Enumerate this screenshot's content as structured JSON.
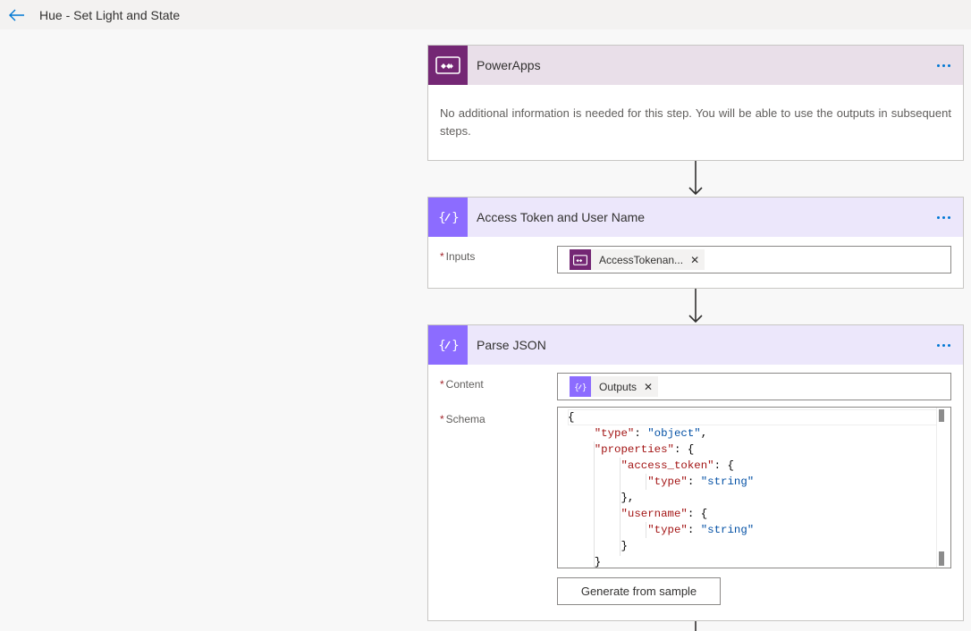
{
  "header": {
    "title": "Hue - Set Light and State",
    "back_icon": "back-arrow-icon"
  },
  "steps": [
    {
      "title": "PowerApps",
      "icon": "powerapps-icon",
      "color": "#742774",
      "body_text": "No additional information is needed for this step. You will be able to use the outputs in subsequent steps."
    },
    {
      "title": "Access Token and User Name",
      "icon": "variable-icon",
      "color": "#8c6cff",
      "fields": [
        {
          "label": "Inputs",
          "required": "*",
          "token": {
            "label": "AccessTokenan...",
            "icon": "powerapps-icon"
          }
        }
      ]
    },
    {
      "title": "Parse JSON",
      "icon": "variable-icon",
      "color": "#8c6cff",
      "fields": [
        {
          "label": "Content",
          "required": "*",
          "token": {
            "label": "Outputs",
            "icon": "variable-icon"
          }
        },
        {
          "label": "Schema",
          "required": "*"
        }
      ],
      "schema_lines": [
        "{",
        "    \"type\": \"object\",",
        "    \"properties\": {",
        "        \"access_token\": {",
        "            \"type\": \"string\"",
        "        },",
        "        \"username\": {",
        "            \"type\": \"string\"",
        "        }",
        "    }"
      ],
      "generate_button": "Generate from sample"
    }
  ],
  "more_icon": "more-options-icon",
  "connector_icon": "down-arrow-icon",
  "colors": {
    "accent": "#0078d4",
    "json_key": "#a31515",
    "json_value": "#0451a5"
  }
}
